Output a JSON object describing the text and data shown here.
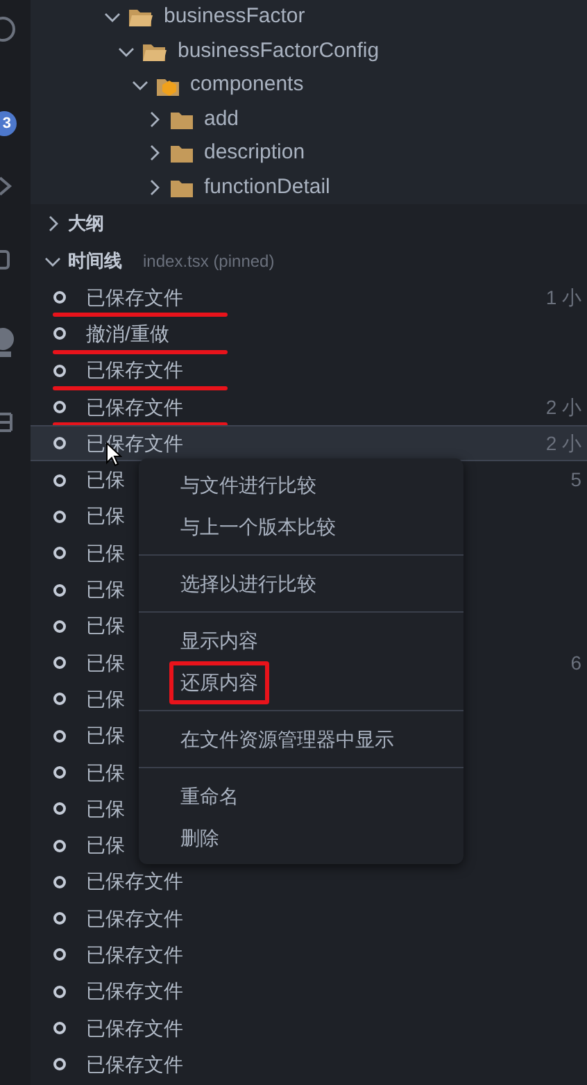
{
  "activity_bar": {
    "badge": "3"
  },
  "explorer": {
    "tree": [
      {
        "label": "businessFactor",
        "expanded": true,
        "children": [
          {
            "label": "businessFactorConfig",
            "expanded": true,
            "children": [
              {
                "label": "components",
                "expanded": true,
                "kind": "special",
                "children": [
                  {
                    "label": "add",
                    "expanded": false
                  },
                  {
                    "label": "description",
                    "expanded": false
                  },
                  {
                    "label": "functionDetail",
                    "expanded": false
                  }
                ]
              }
            ]
          }
        ]
      }
    ]
  },
  "sections": [
    {
      "title": "大纲",
      "expanded": false
    },
    {
      "title": "时间线",
      "expanded": true,
      "detail": "index.tsx (pinned)"
    }
  ],
  "timeline": [
    {
      "label": "已保存文件",
      "time": "1 小",
      "selected": false,
      "underlined": true
    },
    {
      "label": "撤消/重做",
      "selected": false,
      "underlined": true
    },
    {
      "label": "已保存文件",
      "selected": false,
      "underlined": true
    },
    {
      "label": "已保存文件",
      "time": "2 小",
      "selected": false,
      "underlined": true
    },
    {
      "label": "已保存文件",
      "time": "2 小",
      "selected": true,
      "underlined": false
    },
    {
      "label": "已保",
      "time": "5",
      "selected": false,
      "underlined": false
    },
    {
      "label": "已保",
      "selected": false,
      "underlined": false
    },
    {
      "label": "已保",
      "selected": false,
      "underlined": false
    },
    {
      "label": "已保",
      "selected": false,
      "underlined": false
    },
    {
      "label": "已保",
      "selected": false,
      "underlined": false
    },
    {
      "label": "已保",
      "time": "6",
      "selected": false,
      "underlined": false
    },
    {
      "label": "已保",
      "selected": false,
      "underlined": false
    },
    {
      "label": "已保",
      "selected": false,
      "underlined": false
    },
    {
      "label": "已保",
      "selected": false,
      "underlined": false
    },
    {
      "label": "已保",
      "selected": false,
      "underlined": false
    },
    {
      "label": "已保",
      "selected": false,
      "underlined": false
    },
    {
      "label": "已保存文件",
      "selected": false,
      "underlined": false
    },
    {
      "label": "已保存文件",
      "selected": false,
      "underlined": false
    },
    {
      "label": "已保存文件",
      "selected": false,
      "underlined": false
    },
    {
      "label": "已保存文件",
      "selected": false,
      "underlined": false
    },
    {
      "label": "已保存文件",
      "selected": false,
      "underlined": false
    },
    {
      "label": "已保存文件",
      "selected": false,
      "underlined": false
    }
  ],
  "context_menu": {
    "groups": [
      [
        {
          "label": "与文件进行比较",
          "boxed": false
        },
        {
          "label": "与上一个版本比较",
          "boxed": false
        }
      ],
      [
        {
          "label": "选择以进行比较",
          "boxed": false
        }
      ],
      [
        {
          "label": "显示内容",
          "boxed": false
        },
        {
          "label": "还原内容",
          "boxed": true
        }
      ],
      [
        {
          "label": "在文件资源管理器中显示",
          "boxed": false
        }
      ],
      [
        {
          "label": "重命名",
          "boxed": false
        },
        {
          "label": "删除",
          "boxed": false
        }
      ]
    ]
  }
}
